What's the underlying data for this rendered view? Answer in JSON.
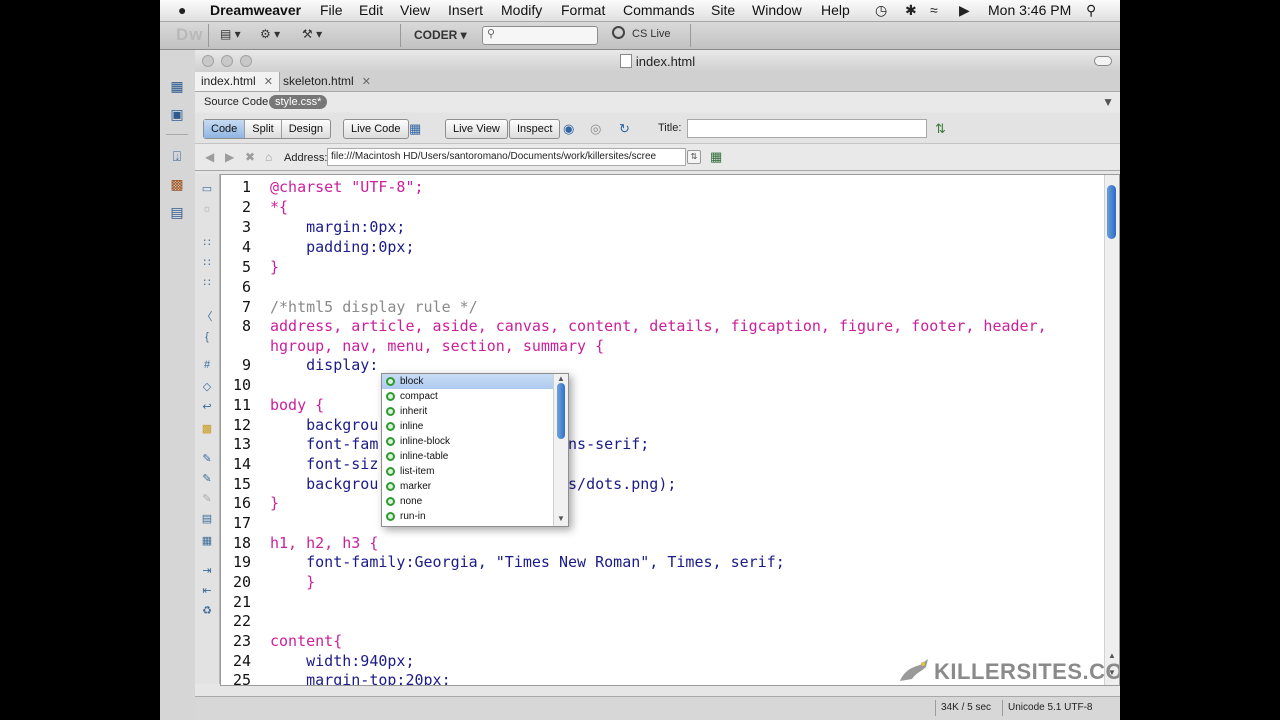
{
  "menubar": {
    "app": "Dreamweaver",
    "items": [
      "File",
      "Edit",
      "View",
      "Insert",
      "Modify",
      "Format",
      "Commands",
      "Site",
      "Window",
      "Help"
    ],
    "clock": "Mon 3:46 PM"
  },
  "appbar": {
    "logo": "Dw",
    "workspace": "CODER",
    "cs_live": "CS Live"
  },
  "window": {
    "title": "index.html"
  },
  "tabs": [
    {
      "label": "index.html",
      "close": "✕"
    },
    {
      "label": "skeleton.html",
      "close": "✕"
    }
  ],
  "related": {
    "label": "Source Code",
    "file": "style.css*"
  },
  "toolbar": {
    "views": [
      "Code",
      "Split",
      "Design"
    ],
    "live_code": "Live Code",
    "live_view": "Live View",
    "inspect": "Inspect",
    "title_label": "Title:",
    "title_value": ""
  },
  "address": {
    "label": "Address:",
    "value": "file:///Macintosh HD/Users/santoromano/Documents/work/killersites/scree"
  },
  "code": {
    "line_numbers": [
      "1",
      "2",
      "3",
      "4",
      "5",
      "6",
      "7",
      "8",
      "",
      "9",
      "10",
      "11",
      "12",
      "13",
      "14",
      "15",
      "16",
      "17",
      "18",
      "19",
      "20",
      "21",
      "22",
      "23",
      "24",
      "25"
    ],
    "lines": [
      "@charset \"UTF-8\";",
      "*{",
      "    margin:0px;",
      "    padding:0px;",
      "}",
      "",
      "/*html5 display rule */",
      "address, article, aside, canvas, content, details, figcaption, figure, footer, header,",
      "hgroup, nav, menu, section, summary {",
      "    display:",
      "",
      "body {",
      "    backgrou",
      "    font-fam                   sans-serif;",
      "    font-siz",
      "    backgrou                   ges/dots.png);",
      "}",
      "",
      "h1, h2, h3 {",
      "    font-family:Georgia, \"Times New Roman\", Times, serif;",
      "    }",
      "",
      "",
      "content{",
      "    width:940px;",
      "    margin-top:20px;"
    ]
  },
  "hints": {
    "items": [
      "block",
      "compact",
      "inherit",
      "inline",
      "inline-block",
      "inline-table",
      "list-item",
      "marker",
      "none",
      "run-in"
    ],
    "selected_index": 0
  },
  "status": {
    "size": "34K / 5 sec",
    "encoding": "Unicode 5.1 UTF-8"
  },
  "watermark": "KILLERSITES.COM",
  "colors": {
    "selector": "#cc1f9b",
    "string": "#2a7a2a",
    "comment": "#8a8a8a",
    "accent": "#3272c8"
  }
}
